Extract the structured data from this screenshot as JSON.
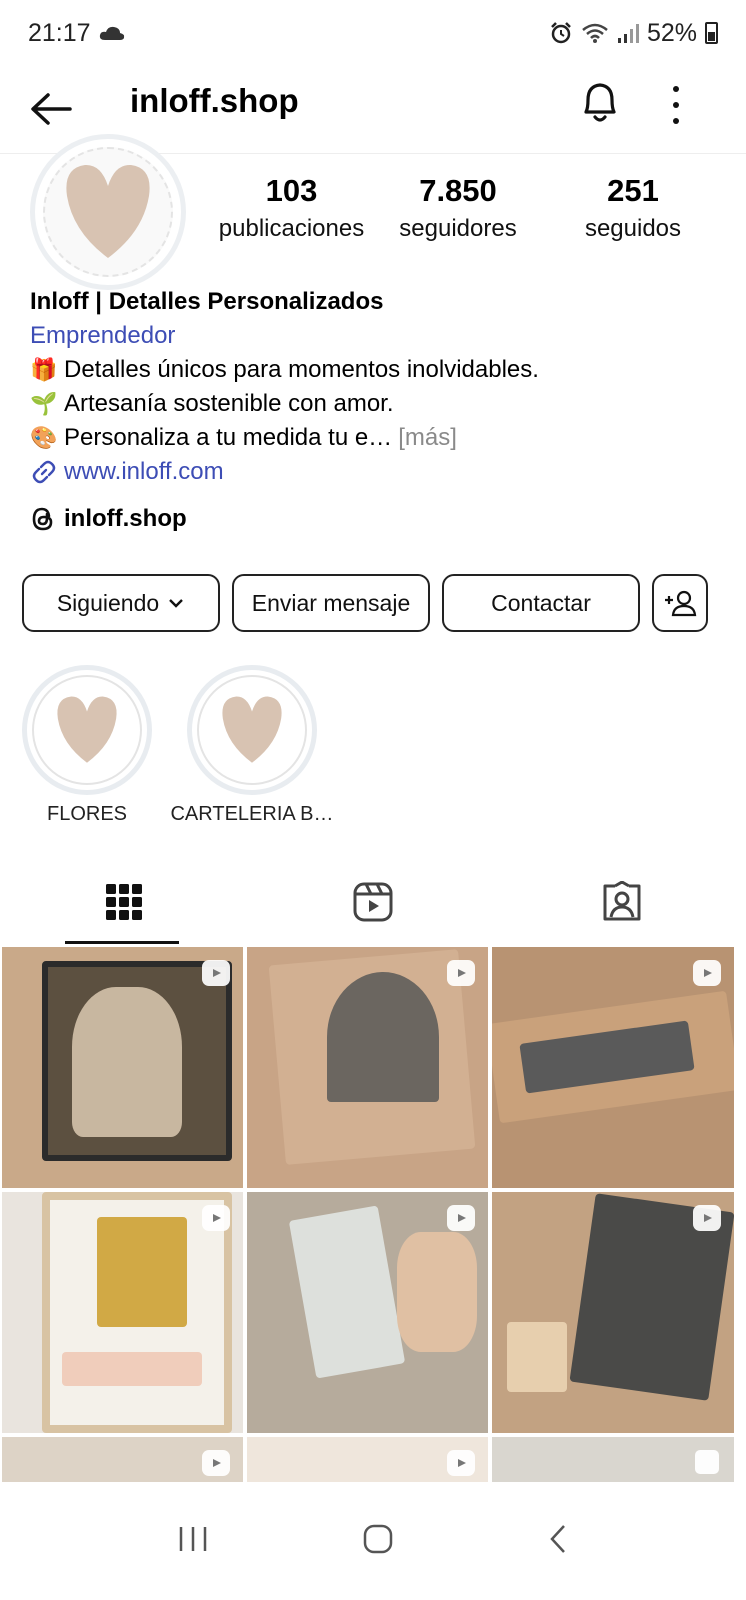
{
  "status": {
    "time": "21:17",
    "battery": "52%"
  },
  "header": {
    "username": "inloff.shop"
  },
  "profile": {
    "stats": [
      {
        "value": "103",
        "label": "publicaciones"
      },
      {
        "value": "7.850",
        "label": "seguidores"
      },
      {
        "value": "251",
        "label": "seguidos"
      }
    ],
    "name": "Inloff | Detalles Personalizados",
    "category": "Emprendedor",
    "bio_lines": [
      {
        "emoji": "🎁",
        "text": "Detalles únicos para momentos inolvidables."
      },
      {
        "emoji": "🌱",
        "text": "Artesanía sostenible con amor."
      },
      {
        "emoji": "🎨",
        "text": "Personaliza a tu medida tu e…",
        "more": "[más]"
      }
    ],
    "link": "www.inloff.com",
    "threads_handle": "inloff.shop"
  },
  "actions": {
    "following": "Siguiendo",
    "message": "Enviar mensaje",
    "contact": "Contactar"
  },
  "highlights": [
    {
      "label": "FLORES"
    },
    {
      "label": "CARTELERIA B…"
    }
  ],
  "colors": {
    "accent_link": "#3d4db5",
    "heart": "#d8c3b2"
  },
  "tabs": [
    "grid-icon",
    "reels-icon",
    "tagged-icon"
  ]
}
